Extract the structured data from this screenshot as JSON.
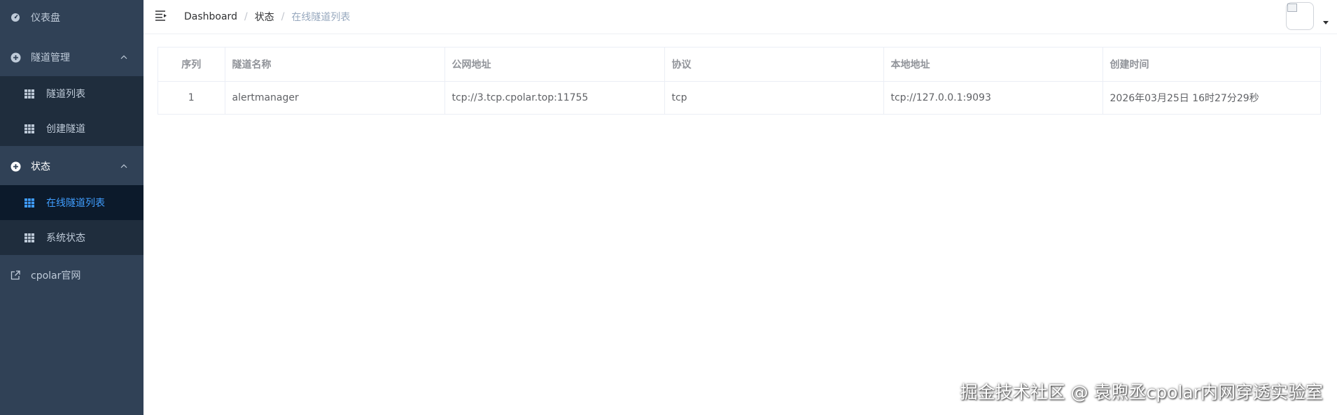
{
  "sidebar": {
    "dashboard": "仪表盘",
    "tunnel_mgmt": {
      "label": "隧道管理",
      "items": [
        "隧道列表",
        "创建隧道"
      ]
    },
    "status": {
      "label": "状态",
      "items": [
        "在线隧道列表",
        "系统状态"
      ]
    },
    "website": "cpolar官网"
  },
  "breadcrumb": [
    "Dashboard",
    "状态",
    "在线隧道列表"
  ],
  "breadcrumb_sep": "/",
  "table": {
    "headers": [
      "序列",
      "隧道名称",
      "公网地址",
      "协议",
      "本地地址",
      "创建时间"
    ],
    "rows": [
      [
        "1",
        "alertmanager",
        "tcp://3.tcp.cpolar.top:11755",
        "tcp",
        "tcp://127.0.0.1:9093",
        "2026年03月25日 16时27分29秒"
      ]
    ]
  },
  "watermark": "掘金技术社区 @ 袁煦丞cpolar内网穿透实验室",
  "colors": {
    "sidebar_bg": "#304156",
    "submenu_bg": "#1f2d3d",
    "active": "#409eff"
  }
}
